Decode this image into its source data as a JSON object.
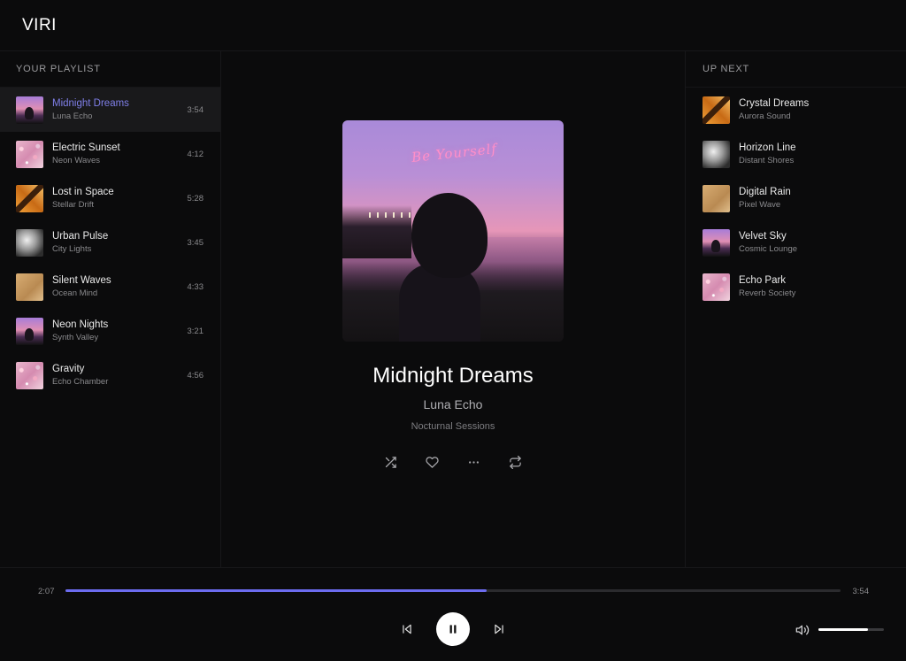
{
  "app": {
    "logo": "VIRI"
  },
  "playlist": {
    "title": "YOUR PLAYLIST",
    "items": [
      {
        "title": "Midnight Dreams",
        "artist": "Luna Echo",
        "duration": "3:54",
        "art": "sunset",
        "active": true
      },
      {
        "title": "Electric Sunset",
        "artist": "Neon Waves",
        "duration": "4:12",
        "art": "sparkle"
      },
      {
        "title": "Lost in Space",
        "artist": "Stellar Drift",
        "duration": "5:28",
        "art": "amber"
      },
      {
        "title": "Urban Pulse",
        "artist": "City Lights",
        "duration": "3:45",
        "art": "bw"
      },
      {
        "title": "Silent Waves",
        "artist": "Ocean Mind",
        "duration": "4:33",
        "art": "beige"
      },
      {
        "title": "Neon Nights",
        "artist": "Synth Valley",
        "duration": "3:21",
        "art": "sunset"
      },
      {
        "title": "Gravity",
        "artist": "Echo Chamber",
        "duration": "4:56",
        "art": "sparkle"
      }
    ]
  },
  "up_next": {
    "title": "UP NEXT",
    "items": [
      {
        "title": "Crystal Dreams",
        "artist": "Aurora Sound",
        "art": "amber"
      },
      {
        "title": "Horizon Line",
        "artist": "Distant Shores",
        "art": "bw"
      },
      {
        "title": "Digital Rain",
        "artist": "Pixel Wave",
        "art": "beige"
      },
      {
        "title": "Velvet Sky",
        "artist": "Cosmic Lounge",
        "art": "sunset"
      },
      {
        "title": "Echo Park",
        "artist": "Reverb Society",
        "art": "sparkle"
      }
    ]
  },
  "now_playing": {
    "cover_text": "Be Yourself",
    "title": "Midnight Dreams",
    "artist": "Luna Echo",
    "album": "Nocturnal Sessions",
    "actions": [
      "shuffle-icon",
      "heart-icon",
      "more-icon",
      "repeat-icon"
    ]
  },
  "player": {
    "elapsed": "2:07",
    "total": "3:54",
    "progress_fraction": 0.543,
    "volume_fraction": 0.76,
    "controls": [
      "previous-icon",
      "pause-icon",
      "next-icon",
      "volume-icon"
    ]
  },
  "colors": {
    "accent": "#6c6cf0",
    "active_title": "#7f7fe8",
    "background": "#0b0b0c"
  }
}
